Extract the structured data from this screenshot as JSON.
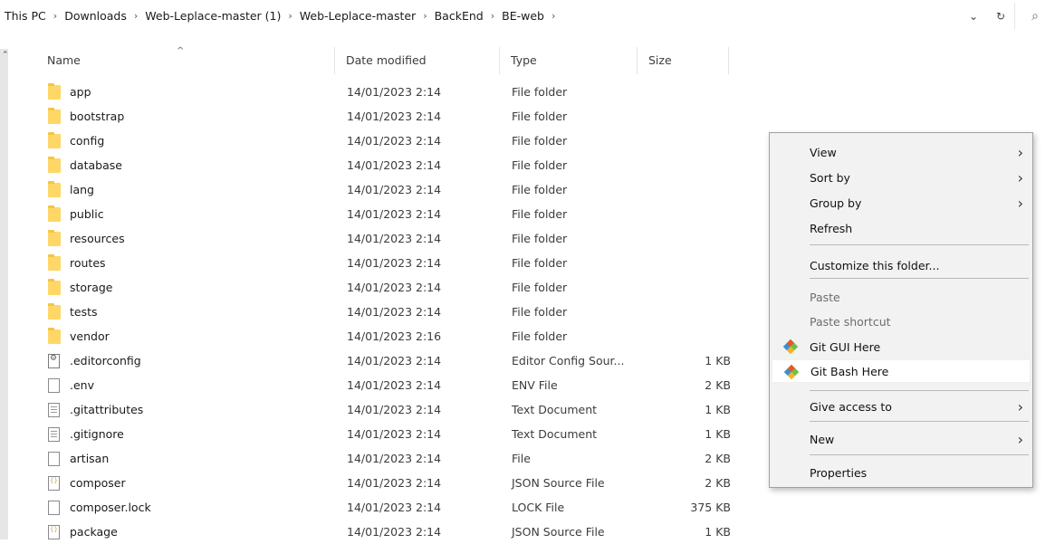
{
  "breadcrumb": [
    "This PC",
    "Downloads",
    "Web-Leplace-master (1)",
    "Web-Leplace-master",
    "BackEnd",
    "BE-web"
  ],
  "columns": {
    "name": "Name",
    "date": "Date modified",
    "type": "Type",
    "size": "Size"
  },
  "files": [
    {
      "icon": "folder",
      "name": "app",
      "date": "14/01/2023 2:14",
      "type": "File folder",
      "size": ""
    },
    {
      "icon": "folder",
      "name": "bootstrap",
      "date": "14/01/2023 2:14",
      "type": "File folder",
      "size": ""
    },
    {
      "icon": "folder",
      "name": "config",
      "date": "14/01/2023 2:14",
      "type": "File folder",
      "size": ""
    },
    {
      "icon": "folder",
      "name": "database",
      "date": "14/01/2023 2:14",
      "type": "File folder",
      "size": ""
    },
    {
      "icon": "folder",
      "name": "lang",
      "date": "14/01/2023 2:14",
      "type": "File folder",
      "size": ""
    },
    {
      "icon": "folder",
      "name": "public",
      "date": "14/01/2023 2:14",
      "type": "File folder",
      "size": ""
    },
    {
      "icon": "folder",
      "name": "resources",
      "date": "14/01/2023 2:14",
      "type": "File folder",
      "size": ""
    },
    {
      "icon": "folder",
      "name": "routes",
      "date": "14/01/2023 2:14",
      "type": "File folder",
      "size": ""
    },
    {
      "icon": "folder",
      "name": "storage",
      "date": "14/01/2023 2:14",
      "type": "File folder",
      "size": ""
    },
    {
      "icon": "folder",
      "name": "tests",
      "date": "14/01/2023 2:14",
      "type": "File folder",
      "size": ""
    },
    {
      "icon": "folder",
      "name": "vendor",
      "date": "14/01/2023 2:16",
      "type": "File folder",
      "size": ""
    },
    {
      "icon": "config-file",
      "name": ".editorconfig",
      "date": "14/01/2023 2:14",
      "type": "Editor Config Sour...",
      "size": "1 KB"
    },
    {
      "icon": "file",
      "name": ".env",
      "date": "14/01/2023 2:14",
      "type": "ENV File",
      "size": "2 KB"
    },
    {
      "icon": "text-file",
      "name": ".gitattributes",
      "date": "14/01/2023 2:14",
      "type": "Text Document",
      "size": "1 KB"
    },
    {
      "icon": "text-file",
      "name": ".gitignore",
      "date": "14/01/2023 2:14",
      "type": "Text Document",
      "size": "1 KB"
    },
    {
      "icon": "file",
      "name": "artisan",
      "date": "14/01/2023 2:14",
      "type": "File",
      "size": "2 KB"
    },
    {
      "icon": "json-file",
      "name": "composer",
      "date": "14/01/2023 2:14",
      "type": "JSON Source File",
      "size": "2 KB"
    },
    {
      "icon": "file",
      "name": "composer.lock",
      "date": "14/01/2023 2:14",
      "type": "LOCK File",
      "size": "375 KB"
    },
    {
      "icon": "json-file",
      "name": "package",
      "date": "14/01/2023 2:14",
      "type": "JSON Source File",
      "size": "1 KB"
    }
  ],
  "context_menu": [
    {
      "label": "View",
      "submenu": true
    },
    {
      "label": "Sort by",
      "submenu": true
    },
    {
      "label": "Group by",
      "submenu": true
    },
    {
      "label": "Refresh"
    },
    {
      "label": "Customize this folder..."
    },
    {
      "label": "Paste",
      "disabled": true
    },
    {
      "label": "Paste shortcut",
      "disabled": true
    },
    {
      "label": "Git GUI Here",
      "icon": "git-icon"
    },
    {
      "label": "Git Bash Here",
      "icon": "git-icon",
      "highlighted": true
    },
    {
      "label": "Give access to",
      "submenu": true
    },
    {
      "label": "New",
      "submenu": true
    },
    {
      "label": "Properties"
    }
  ]
}
